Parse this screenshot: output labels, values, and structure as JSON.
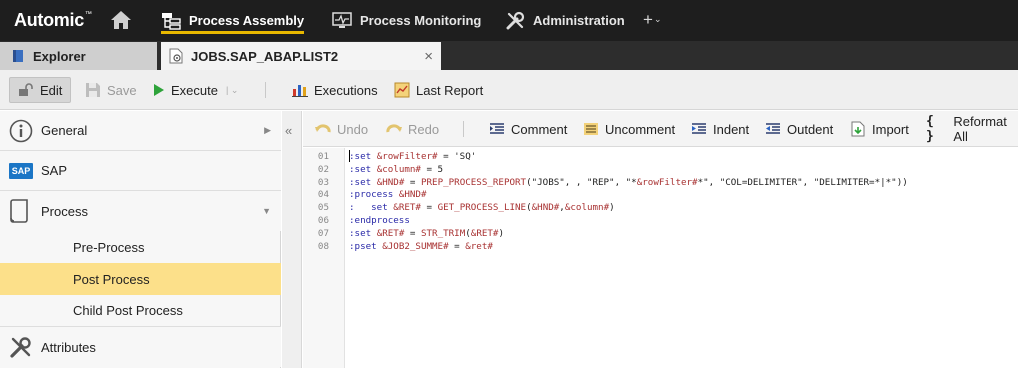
{
  "topnav": {
    "logo": "Automic",
    "logo_mark": "™",
    "tabs": [
      {
        "label": "Process Assembly",
        "icon": "process-assembly-icon",
        "active": true
      },
      {
        "label": "Process Monitoring",
        "icon": "process-monitoring-icon",
        "active": false
      },
      {
        "label": "Administration",
        "icon": "wrench-screwdriver-icon",
        "active": false
      }
    ],
    "plus": "+",
    "plus_chevron": "⌄"
  },
  "tabs": {
    "explorer": "Explorer",
    "document": "JOBS.SAP_ABAP.LIST2",
    "close": "×"
  },
  "toolbar": {
    "edit": "Edit",
    "save": "Save",
    "execute": "Execute",
    "executions": "Executions",
    "last_report": "Last Report"
  },
  "sidebar": {
    "sections": [
      {
        "label": "General",
        "icon": "info-icon"
      },
      {
        "label": "SAP",
        "icon": "sap-logo-icon",
        "badge": "SAP"
      },
      {
        "label": "Process",
        "icon": "document-icon"
      }
    ],
    "process_items": [
      {
        "label": "Pre-Process",
        "selected": false
      },
      {
        "label": "Post Process",
        "selected": true
      },
      {
        "label": "Child Post Process",
        "selected": false
      }
    ],
    "attributes": "Attributes",
    "collapse": "«"
  },
  "editor_toolbar": {
    "undo": "Undo",
    "redo": "Redo",
    "comment": "Comment",
    "uncomment": "Uncomment",
    "indent": "Indent",
    "outdent": "Outdent",
    "import": "Import",
    "reformat": "Reformat All",
    "reformat_glyph": "{ }"
  },
  "code": {
    "lines": [
      {
        "num": "01",
        "text": ":set &rowFilter# = 'SQ'"
      },
      {
        "num": "02",
        "text": ":set &column# = 5"
      },
      {
        "num": "03",
        "text": ":set &HND# = PREP_PROCESS_REPORT(\"JOBS\", , \"REP\", \"*&rowFilter#*\", \"COL=DELIMITER\", \"DELIMITER=*|*\"))"
      },
      {
        "num": "04",
        "text": ":process &HND#"
      },
      {
        "num": "05",
        "text": ":   set &RET# = GET_PROCESS_LINE(&HND#,&column#)"
      },
      {
        "num": "06",
        "text": ":endprocess"
      },
      {
        "num": "07",
        "text": ":set &RET# = STR_TRIM(&RET#)"
      },
      {
        "num": "08",
        "text": ":pset &JOB2_SUMME# = &ret#"
      }
    ]
  },
  "colors": {
    "accent": "#e8b800",
    "selected_row": "#fce08a",
    "topbar": "#1e1e1e",
    "execute_green": "#2ea33a",
    "sap_blue": "#1b76c6"
  }
}
